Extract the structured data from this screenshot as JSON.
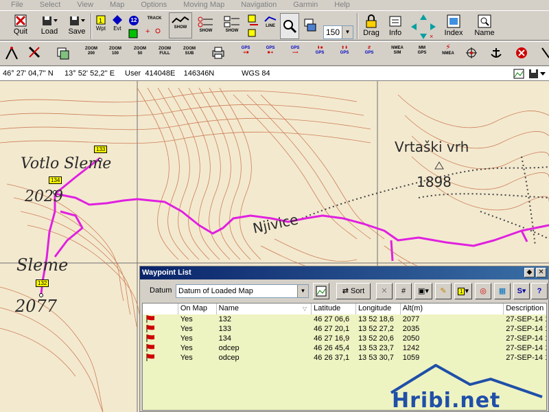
{
  "menu": [
    "File",
    "Select",
    "View",
    "Map",
    "Options",
    "Moving Map",
    "Navigation",
    "Garmin",
    "Help"
  ],
  "toolbar": {
    "quit": "Quit",
    "load": "Load",
    "save": "Save",
    "wpt": "Wpt",
    "evt": "Evt",
    "track_count": "12",
    "track": "TRACK",
    "show": "SHOW",
    "line": "LINE",
    "zoom_value": "150",
    "drag": "Drag",
    "info": "Info",
    "index": "Index",
    "name": "Name"
  },
  "toolbar2": {
    "zoom": "ZOOM",
    "zoom200": "200",
    "zoom100": "100",
    "zoom50": "50",
    "zoomfull": "FULL",
    "zoomsub": "SUB",
    "gps": "GPS",
    "nmea": "NMEA",
    "nmeasim": "SIM",
    "mm": "MM",
    "mmgps": "GPS"
  },
  "coords": {
    "lat": "46° 27' 04,7'' N",
    "lon": "13° 52' 52,2'' E",
    "user": "User  414048E    146346N",
    "datum": "WGS 84"
  },
  "map": {
    "labels": {
      "votlo": "Votlo Sleme",
      "votlo_alt": "2029",
      "sleme": "Sleme",
      "sleme_alt": "2077",
      "vrtaski": "Vrtaški vrh",
      "vrtaski_alt": "1898",
      "njivice": "Njivice"
    },
    "waypoint_tags": [
      "133",
      "134",
      "132"
    ]
  },
  "dialog": {
    "title": "Waypoint List",
    "datum_label": "Datum",
    "datum_value": "Datum of Loaded Map",
    "sort": "Sort",
    "columns": [
      "",
      "On Map",
      "Name",
      "Latitude",
      "Longitude",
      "Alt(m)",
      "Description"
    ],
    "rows": [
      {
        "onmap": "Yes",
        "name": "132",
        "lat": "46 27 06,6",
        "lon": "13 52 18,6",
        "alt": "2077",
        "desc": "27-SEP-14 1"
      },
      {
        "onmap": "Yes",
        "name": "133",
        "lat": "46 27 20,1",
        "lon": "13 52 27,2",
        "alt": "2035",
        "desc": "27-SEP-14 1"
      },
      {
        "onmap": "Yes",
        "name": "134",
        "lat": "46 27 16,9",
        "lon": "13 52 20,6",
        "alt": "2050",
        "desc": "27-SEP-14 1"
      },
      {
        "onmap": "Yes",
        "name": "odcep",
        "lat": "46 26 45,4",
        "lon": "13 53 23,7",
        "alt": "1242",
        "desc": "27-SEP-14 1"
      },
      {
        "onmap": "Yes",
        "name": "odcep",
        "lat": "46 26 37,1",
        "lon": "13 53 30,7",
        "alt": "1059",
        "desc": "27-SEP-14 1"
      }
    ]
  },
  "watermark": "Hribi.net",
  "colors": {
    "track": "#e020e0",
    "contour": "#c8734a",
    "map_bg": "#f3e9cf",
    "row_bg": "#eef3c2",
    "title_start": "#0a246a",
    "title_end": "#3a6ea5",
    "watermark_blue": "#1f4fa8"
  }
}
